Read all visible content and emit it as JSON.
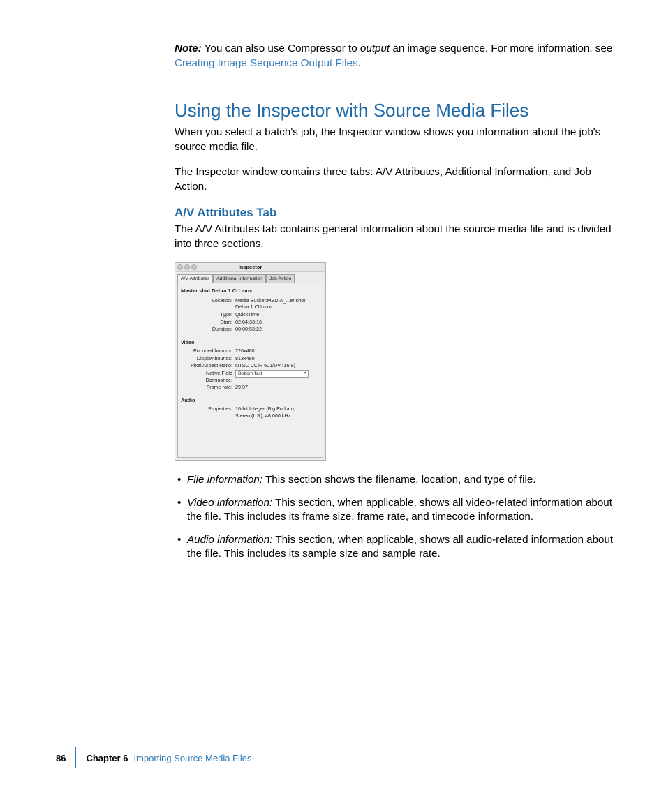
{
  "note": {
    "label": "Note:",
    "pre": "  You can also use Compressor to ",
    "em": "output",
    "post": " an image sequence. For more information, see ",
    "link": "Creating Image Sequence Output Files",
    "end": "."
  },
  "heading1": "Using the Inspector with Source Media Files",
  "para1": "When you select a batch's job, the Inspector window shows you information about the job's source media file.",
  "para2": "The Inspector window contains three tabs: A/V Attributes, Additional Information, and Job Action.",
  "heading2": "A/V Attributes Tab",
  "para3": "The A/V Attributes tab contains general information about the source media file and is divided into three sections.",
  "inspector": {
    "title": "Inspector",
    "tabs": {
      "av": "A/V Attributes",
      "addl": "Additional Information",
      "job": "Job Action"
    },
    "filename": "Master shot Debra 1 CU.mov",
    "file": {
      "location_k": "Location:",
      "location_v": "Media Bucket:MEDIA_...er shot Debra 1 CU.mov",
      "type_k": "Type:",
      "type_v": "QuickTime",
      "start_k": "Start:",
      "start_v": "02:04:33:16",
      "dur_k": "Duration:",
      "dur_v": "00:00:53:22"
    },
    "video": {
      "label": "Video",
      "enc_k": "Encoded bounds:",
      "enc_v": "720x480",
      "disp_k": "Display bounds:",
      "disp_v": "813x480",
      "par_k": "Pixel Aspect Ratio:",
      "par_v": "NTSC CCIR 601/DV (16:9)",
      "nfd_k": "Native Field Dominance:",
      "nfd_v": "Bottom first",
      "fr_k": "Frame rate:",
      "fr_v": "29.97"
    },
    "audio": {
      "label": "Audio",
      "prop_k": "Properties:",
      "prop_v1": "16-bit Integer (Big Endian),",
      "prop_v2": "Stereo (L R), 48.000 kHz"
    }
  },
  "bullets": [
    {
      "label": "File information:",
      "text": "  This section shows the filename, location, and type of file."
    },
    {
      "label": "Video information:",
      "text": "  This section, when applicable, shows all video-related information about the file. This includes its frame size, frame rate, and timecode information."
    },
    {
      "label": "Audio information:",
      "text": "  This section, when applicable, shows all audio-related information about the file. This includes its sample size and sample rate."
    }
  ],
  "footer": {
    "page": "86",
    "chapter": "Chapter 6",
    "title": "Importing Source Media Files"
  }
}
